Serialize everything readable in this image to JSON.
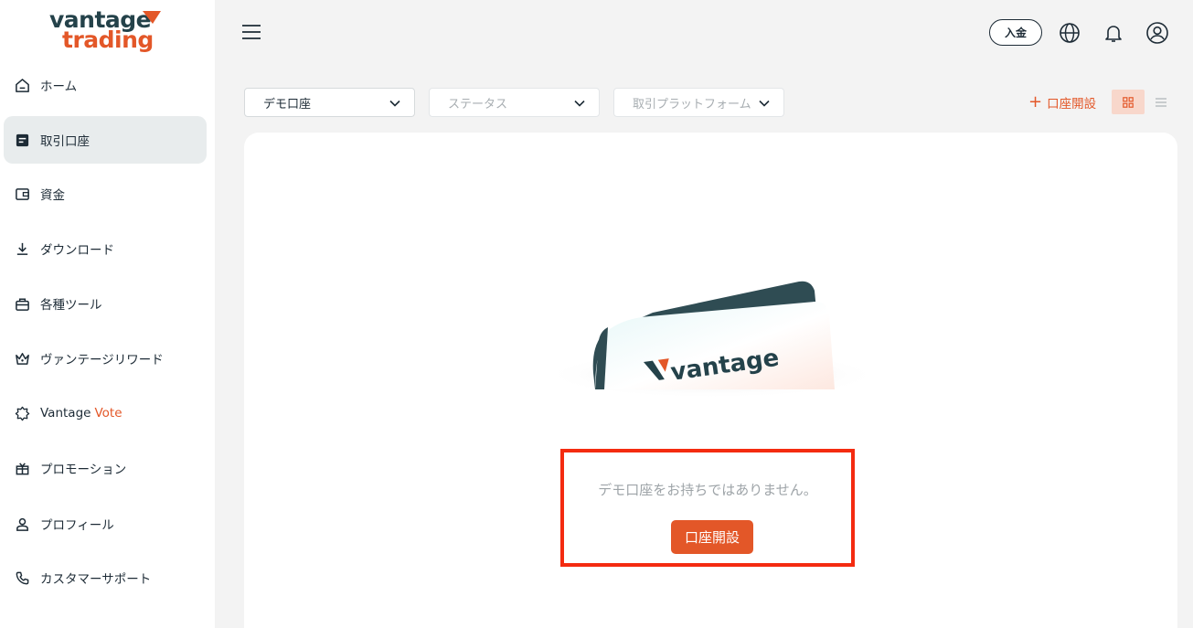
{
  "brand": {
    "line1": "vantage",
    "line2": "trading",
    "accent_color": "#e35728",
    "primary_color": "#24424a"
  },
  "sidebar": {
    "items": [
      {
        "label": "ホーム",
        "icon": "home-icon"
      },
      {
        "label": "取引口座",
        "icon": "account-icon",
        "active": true
      },
      {
        "label": "資金",
        "icon": "wallet-icon"
      },
      {
        "label": "ダウンロード",
        "icon": "download-icon"
      },
      {
        "label": "各種ツール",
        "icon": "toolbox-icon"
      },
      {
        "label": "ヴァンテージリワード",
        "icon": "crown-icon"
      },
      {
        "label": "Vantage",
        "accent": "Vote",
        "icon": "badge-icon"
      },
      {
        "label": "プロモーション",
        "icon": "gift-icon"
      },
      {
        "label": "プロフィール",
        "icon": "user-icon"
      },
      {
        "label": "カスタマーサポート",
        "icon": "phone-icon"
      }
    ]
  },
  "header": {
    "deposit_label": "入金",
    "icons": [
      "globe-icon",
      "bell-icon",
      "profile-icon"
    ]
  },
  "filters": {
    "account_type": "デモ口座",
    "status_placeholder": "ステータス",
    "platform_placeholder": "取引プラットフォーム"
  },
  "toolbar": {
    "open_account_label": "口座開設",
    "view_modes": [
      "grid-view-icon",
      "list-view-icon"
    ]
  },
  "empty_state": {
    "message": "デモ口座をお持ちではありません。",
    "button_label": "口座開設",
    "card_logo_text": "vantage"
  }
}
